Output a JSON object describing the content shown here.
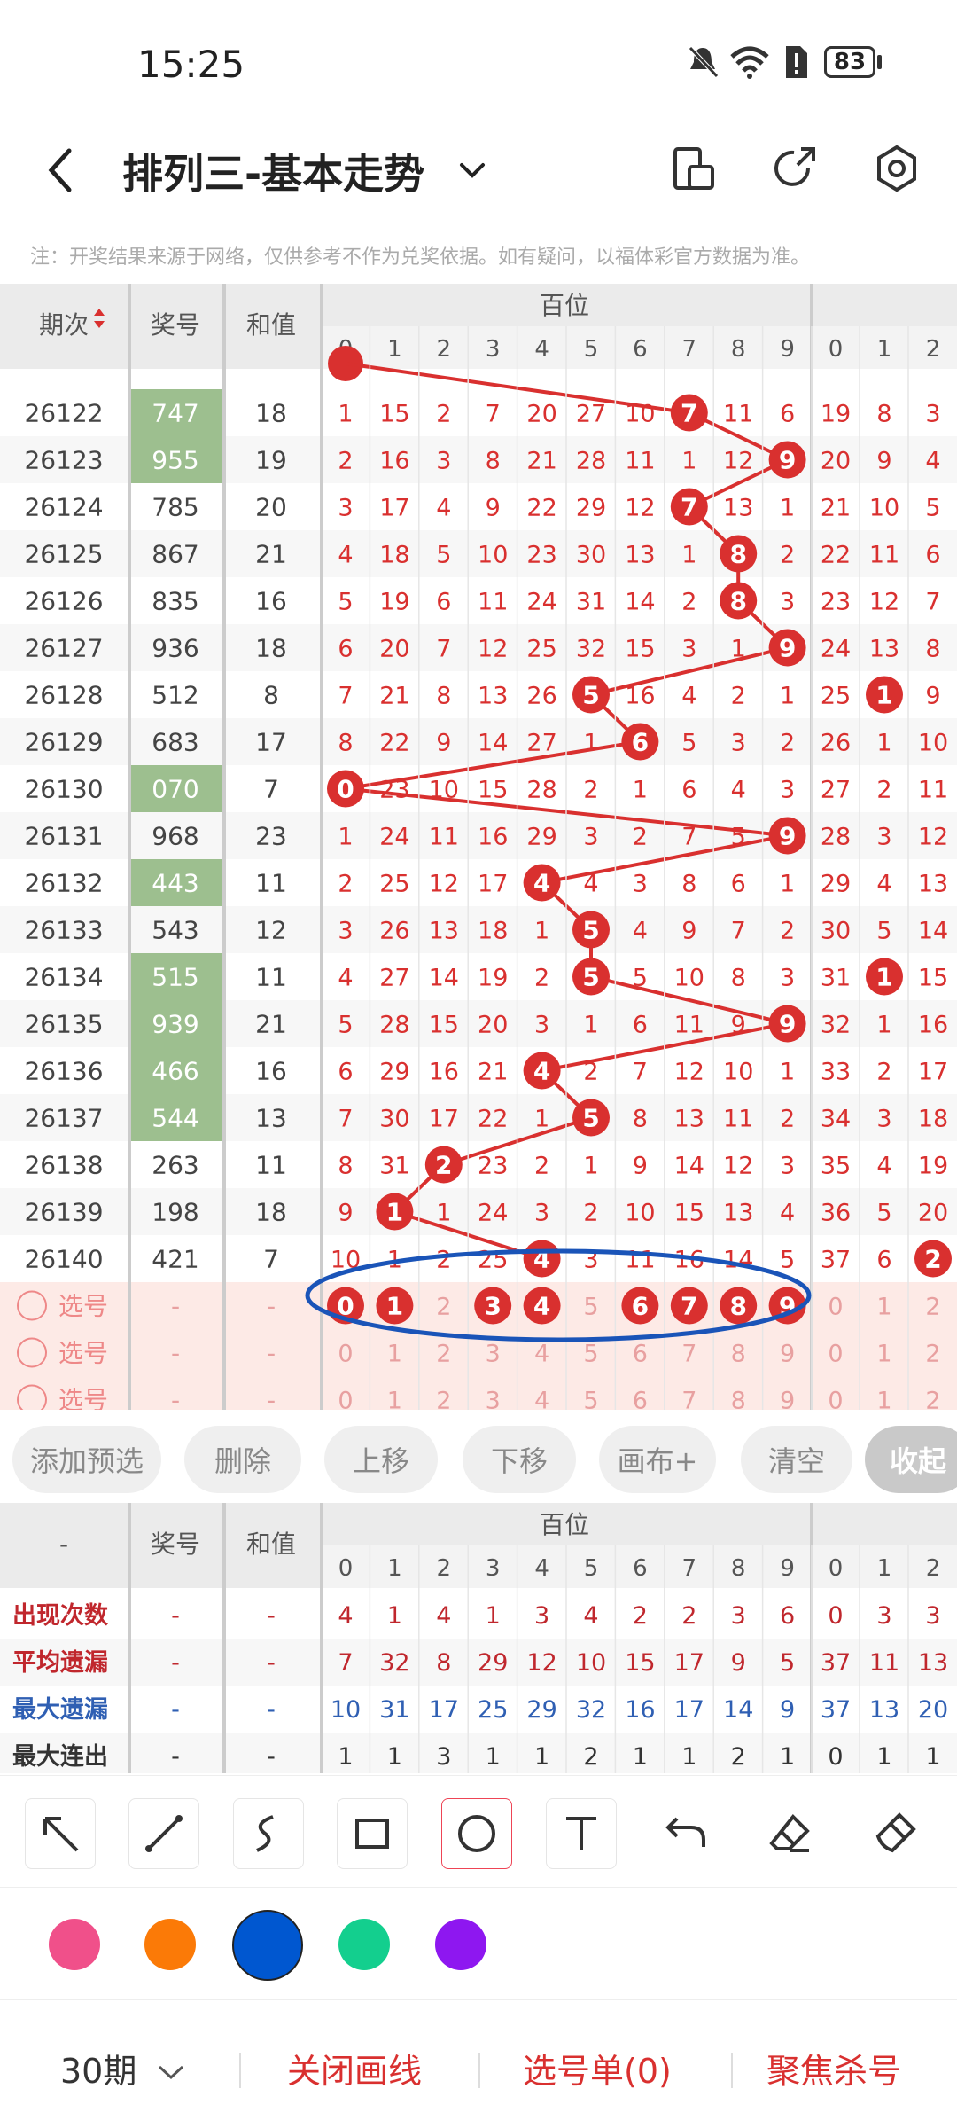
{
  "status": {
    "time": "15:25",
    "battery": "83"
  },
  "header": {
    "title": "排列三-基本走势"
  },
  "note": "注：开奖结果来源于网络，仅供参考不作为兑奖依据。如有疑问，以福体彩官方数据为准。",
  "table": {
    "col_period": "期次",
    "col_number": "奖号",
    "col_sum": "和值",
    "group_label": "百位",
    "digits": [
      "0",
      "1",
      "2",
      "3",
      "4",
      "5",
      "6",
      "7",
      "8",
      "9"
    ],
    "extra_digits": [
      "0",
      "1",
      "2"
    ],
    "rows": [
      {
        "period": "26122",
        "number": "747",
        "sum": "18",
        "green": true,
        "cells": [
          "1",
          "15",
          "2",
          "7",
          "20",
          "27",
          "10",
          "7",
          "11",
          "6"
        ],
        "extra": [
          "19",
          "8",
          "3"
        ],
        "hit": 7,
        "xhit": -1
      },
      {
        "period": "26123",
        "number": "955",
        "sum": "19",
        "green": true,
        "cells": [
          "2",
          "16",
          "3",
          "8",
          "21",
          "28",
          "11",
          "1",
          "12",
          "9"
        ],
        "extra": [
          "20",
          "9",
          "4"
        ],
        "hit": 9,
        "xhit": -1
      },
      {
        "period": "26124",
        "number": "785",
        "sum": "20",
        "green": false,
        "cells": [
          "3",
          "17",
          "4",
          "9",
          "22",
          "29",
          "12",
          "7",
          "13",
          "1"
        ],
        "extra": [
          "21",
          "10",
          "5"
        ],
        "hit": 7,
        "xhit": -1
      },
      {
        "period": "26125",
        "number": "867",
        "sum": "21",
        "green": false,
        "cells": [
          "4",
          "18",
          "5",
          "10",
          "23",
          "30",
          "13",
          "1",
          "8",
          "2"
        ],
        "extra": [
          "22",
          "11",
          "6"
        ],
        "hit": 8,
        "xhit": -1
      },
      {
        "period": "26126",
        "number": "835",
        "sum": "16",
        "green": false,
        "cells": [
          "5",
          "19",
          "6",
          "11",
          "24",
          "31",
          "14",
          "2",
          "8",
          "3"
        ],
        "extra": [
          "23",
          "12",
          "7"
        ],
        "hit": 8,
        "xhit": -1
      },
      {
        "period": "26127",
        "number": "936",
        "sum": "18",
        "green": false,
        "cells": [
          "6",
          "20",
          "7",
          "12",
          "25",
          "32",
          "15",
          "3",
          "1",
          "9"
        ],
        "extra": [
          "24",
          "13",
          "8"
        ],
        "hit": 9,
        "xhit": -1
      },
      {
        "period": "26128",
        "number": "512",
        "sum": "8",
        "green": false,
        "cells": [
          "7",
          "21",
          "8",
          "13",
          "26",
          "5",
          "16",
          "4",
          "2",
          "1"
        ],
        "extra": [
          "25",
          "1",
          "9"
        ],
        "hit": 5,
        "xhit": 1
      },
      {
        "period": "26129",
        "number": "683",
        "sum": "17",
        "green": false,
        "cells": [
          "8",
          "22",
          "9",
          "14",
          "27",
          "1",
          "6",
          "5",
          "3",
          "2"
        ],
        "extra": [
          "26",
          "1",
          "10"
        ],
        "hit": 6,
        "xhit": -1
      },
      {
        "period": "26130",
        "number": "070",
        "sum": "7",
        "green": true,
        "cells": [
          "0",
          "23",
          "10",
          "15",
          "28",
          "2",
          "1",
          "6",
          "4",
          "3"
        ],
        "extra": [
          "27",
          "2",
          "11"
        ],
        "hit": 0,
        "xhit": -1
      },
      {
        "period": "26131",
        "number": "968",
        "sum": "23",
        "green": false,
        "cells": [
          "1",
          "24",
          "11",
          "16",
          "29",
          "3",
          "2",
          "7",
          "5",
          "9"
        ],
        "extra": [
          "28",
          "3",
          "12"
        ],
        "hit": 9,
        "xhit": -1
      },
      {
        "period": "26132",
        "number": "443",
        "sum": "11",
        "green": true,
        "cells": [
          "2",
          "25",
          "12",
          "17",
          "4",
          "4",
          "3",
          "8",
          "6",
          "1"
        ],
        "extra": [
          "29",
          "4",
          "13"
        ],
        "hit": 4,
        "xhit": -1
      },
      {
        "period": "26133",
        "number": "543",
        "sum": "12",
        "green": false,
        "cells": [
          "3",
          "26",
          "13",
          "18",
          "1",
          "5",
          "4",
          "9",
          "7",
          "2"
        ],
        "extra": [
          "30",
          "5",
          "14"
        ],
        "hit": 5,
        "xhit": -1
      },
      {
        "period": "26134",
        "number": "515",
        "sum": "11",
        "green": true,
        "cells": [
          "4",
          "27",
          "14",
          "19",
          "2",
          "5",
          "5",
          "10",
          "8",
          "3"
        ],
        "extra": [
          "31",
          "1",
          "15"
        ],
        "hit": 5,
        "xhit": 1
      },
      {
        "period": "26135",
        "number": "939",
        "sum": "21",
        "green": true,
        "cells": [
          "5",
          "28",
          "15",
          "20",
          "3",
          "1",
          "6",
          "11",
          "9",
          "9"
        ],
        "extra": [
          "32",
          "1",
          "16"
        ],
        "hit": 9,
        "xhit": -1
      },
      {
        "period": "26136",
        "number": "466",
        "sum": "16",
        "green": true,
        "cells": [
          "6",
          "29",
          "16",
          "21",
          "4",
          "2",
          "7",
          "12",
          "10",
          "1"
        ],
        "extra": [
          "33",
          "2",
          "17"
        ],
        "hit": 4,
        "xhit": -1
      },
      {
        "period": "26137",
        "number": "544",
        "sum": "13",
        "green": true,
        "cells": [
          "7",
          "30",
          "17",
          "22",
          "1",
          "5",
          "8",
          "13",
          "11",
          "2"
        ],
        "extra": [
          "34",
          "3",
          "18"
        ],
        "hit": 5,
        "xhit": -1
      },
      {
        "period": "26138",
        "number": "263",
        "sum": "11",
        "green": false,
        "cells": [
          "8",
          "31",
          "2",
          "23",
          "2",
          "1",
          "9",
          "14",
          "12",
          "3"
        ],
        "extra": [
          "35",
          "4",
          "19"
        ],
        "hit": 2,
        "xhit": -1
      },
      {
        "period": "26139",
        "number": "198",
        "sum": "18",
        "green": false,
        "cells": [
          "9",
          "1",
          "1",
          "24",
          "3",
          "2",
          "10",
          "15",
          "13",
          "4"
        ],
        "extra": [
          "36",
          "5",
          "20"
        ],
        "hit": 1,
        "xhit": -1
      },
      {
        "period": "26140",
        "number": "421",
        "sum": "7",
        "green": false,
        "cells": [
          "10",
          "1",
          "2",
          "25",
          "4",
          "3",
          "11",
          "16",
          "14",
          "5"
        ],
        "extra": [
          "37",
          "6",
          "2"
        ],
        "hit": 4,
        "xhit": 2
      }
    ],
    "select_label": "选号",
    "select_rows": [
      {
        "selected": [
          0,
          1,
          3,
          4,
          6,
          7,
          8,
          9
        ]
      },
      {
        "selected": []
      },
      {
        "selected": []
      }
    ],
    "dash": "-"
  },
  "actions": [
    "添加预选",
    "删除",
    "上移",
    "下移",
    "画布+",
    "清空",
    "收起"
  ],
  "stats": {
    "corner": "-",
    "col_number": "奖号",
    "col_sum": "和值",
    "group_label": "百位",
    "rows": [
      {
        "label": "出现次数",
        "color": "#c0272d",
        "values": [
          "4",
          "1",
          "4",
          "1",
          "3",
          "4",
          "2",
          "2",
          "3",
          "6"
        ],
        "extra": [
          "0",
          "3",
          "3"
        ]
      },
      {
        "label": "平均遗漏",
        "color": "#c0272d",
        "values": [
          "7",
          "32",
          "8",
          "29",
          "12",
          "10",
          "15",
          "17",
          "9",
          "5"
        ],
        "extra": [
          "37",
          "11",
          "13"
        ]
      },
      {
        "label": "最大遗漏",
        "color": "#2f5fb3",
        "values": [
          "10",
          "31",
          "17",
          "25",
          "29",
          "32",
          "16",
          "17",
          "14",
          "9"
        ],
        "extra": [
          "37",
          "13",
          "20"
        ]
      },
      {
        "label": "最大连出",
        "color": "#333333",
        "values": [
          "1",
          "1",
          "3",
          "1",
          "1",
          "2",
          "1",
          "1",
          "2",
          "1"
        ],
        "extra": [
          "0",
          "1",
          "1"
        ]
      }
    ]
  },
  "draw_tools": [
    "arrow-tool-icon",
    "line-tool-icon",
    "curve-tool-icon",
    "rect-tool-icon",
    "circle-tool-icon",
    "text-tool-icon",
    "undo-icon",
    "eraser-icon",
    "clear-brush-icon"
  ],
  "palette": [
    "#f0508a",
    "#fb7a07",
    "#0057d0",
    "#13cf8e",
    "#8e17f0"
  ],
  "bottom": {
    "periods": "30期",
    "close_line": "关闭画线",
    "selection_list": "选号单(0)",
    "focus_kill": "聚焦杀号"
  }
}
